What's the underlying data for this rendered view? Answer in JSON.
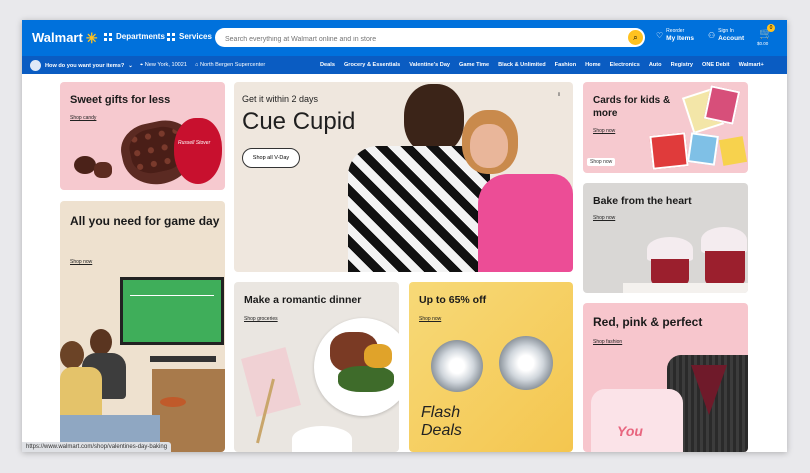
{
  "header": {
    "logo": "Walmart",
    "departments": "Departments",
    "services": "Services",
    "search_placeholder": "Search everything at Walmart online and in store",
    "reorder_top": "Reorder",
    "reorder_bottom": "My Items",
    "signin_top": "Sign In",
    "signin_bottom": "Account",
    "cart_count": "0",
    "cart_total": "$0.00"
  },
  "subnav": {
    "fulfillment": "How do you want your items?",
    "zip": "New York, 10021",
    "store": "North Bergen Supercenter",
    "links": [
      "Deals",
      "Grocery & Essentials",
      "Valentine's Day",
      "Game Time",
      "Black & Unlimited",
      "Fashion",
      "Home",
      "Electronics",
      "Auto",
      "Registry",
      "ONE Debit",
      "Walmart+"
    ]
  },
  "cards": {
    "sweet": {
      "title": "Sweet gifts for less",
      "link": "Shop candy",
      "brand": "Russell Stover"
    },
    "cupid": {
      "kicker": "Get it within 2 days",
      "title": "Cue Cupid",
      "button": "Shop all V-Day"
    },
    "cards_kids": {
      "title": "Cards for kids & more",
      "link": "Shop now",
      "badge": "Shop now"
    },
    "game": {
      "title": "All you need for game day",
      "link": "Shop now"
    },
    "bake": {
      "title": "Bake from the heart",
      "link": "Shop now"
    },
    "dinner": {
      "title": "Make a romantic dinner",
      "link": "Shop groceries"
    },
    "flash": {
      "title": "Up to 65% off",
      "link": "Shop now",
      "label_line1": "Flash",
      "label_line2": "Deals"
    },
    "red": {
      "title": "Red, pink & perfect",
      "link": "Shop fashion",
      "shirt_text": "You"
    }
  },
  "status_url": "https://www.walmart.com/shop/valentines-day-baking",
  "colors": {
    "brand_blue": "#0071dc",
    "spark_yellow": "#ffc220",
    "pink_bg": "#f6c9cf",
    "flash_yellow": "#f7d978"
  }
}
